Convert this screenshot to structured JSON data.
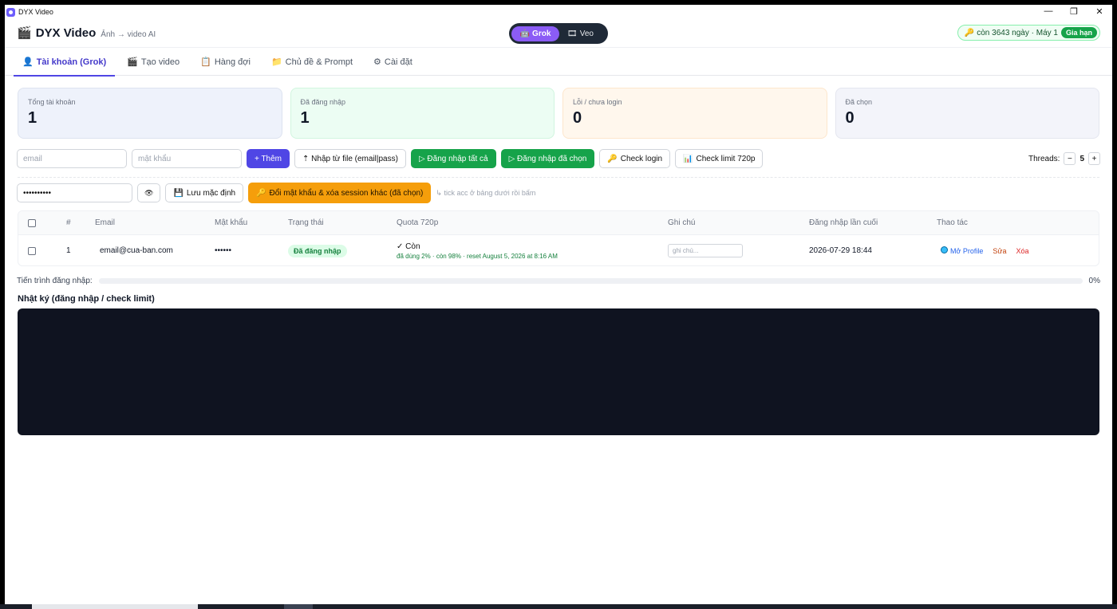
{
  "window": {
    "title": "DYX Video",
    "controls": [
      "—",
      "❐",
      "✕"
    ]
  },
  "header": {
    "brand_name": "DYX Video",
    "brand_sub": "Ảnh → video AI",
    "switch": {
      "grok": "Grok",
      "veo": "Veo"
    },
    "license_text": "còn 3643 ngày · Máy 1",
    "renew_label": "Gia hạn"
  },
  "tabs": [
    {
      "label": "Tài khoản (Grok)",
      "icon": "👤"
    },
    {
      "label": "Tạo video",
      "icon": "🎬"
    },
    {
      "label": "Hàng đợi",
      "icon": "📋"
    },
    {
      "label": "Chủ đề & Prompt",
      "icon": "📁"
    },
    {
      "label": "Cài đặt",
      "icon": "⚙"
    }
  ],
  "stats": [
    {
      "label": "Tổng tài khoản",
      "value": "1"
    },
    {
      "label": "Đã đăng nhập",
      "value": "1"
    },
    {
      "label": "Lỗi / chưa login",
      "value": "0"
    },
    {
      "label": "Đã chọn",
      "value": "0"
    }
  ],
  "toolbar": {
    "email_placeholder": "email",
    "password_placeholder": "mật khẩu",
    "add": "+ Thêm",
    "import": "⇡ Nhập từ file (email|pass)",
    "login_all": "▷ Đăng nhập tất cả",
    "login_selected": "▷ Đăng nhập đã chọn",
    "check_login": "Check login",
    "check_limit": "Check limit 720p",
    "threads_label": "Threads:",
    "threads_minus": "−",
    "threads_value": "5",
    "threads_plus": "+"
  },
  "toolbar2": {
    "default_password": "••••••••••",
    "eye": "👁",
    "save_default": "Lưu mặc định",
    "change_password": "Đổi mật khẩu & xóa session khác (đã chọn)",
    "hint": "↳ tick acc ở bảng dưới rồi bấm"
  },
  "table": {
    "headers": [
      "#",
      "Email",
      "Mật khẩu",
      "Trạng thái",
      "Quota 720p",
      "Ghi chú",
      "Đăng nhập lần cuối",
      "Thao tác"
    ],
    "rows": [
      {
        "index": "1",
        "email": "email@cua-ban.com",
        "password": "••••••",
        "status": "Đã đăng nhập",
        "quota_main": "✓ Còn",
        "quota_sub": "đã dùng 2% · còn 98% · reset August 5, 2026 at 8:16 AM",
        "note_placeholder": "ghi chú...",
        "last_login": "2026-07-29 18:44",
        "open_profile": "Mở Profile",
        "edit": "Sửa",
        "delete": "Xóa"
      }
    ]
  },
  "progress": {
    "label": "Tiến trình đăng nhập:",
    "percent": 0,
    "percent_text": "0%"
  },
  "log": {
    "title": "Nhật ký (đăng nhập / check limit)"
  }
}
